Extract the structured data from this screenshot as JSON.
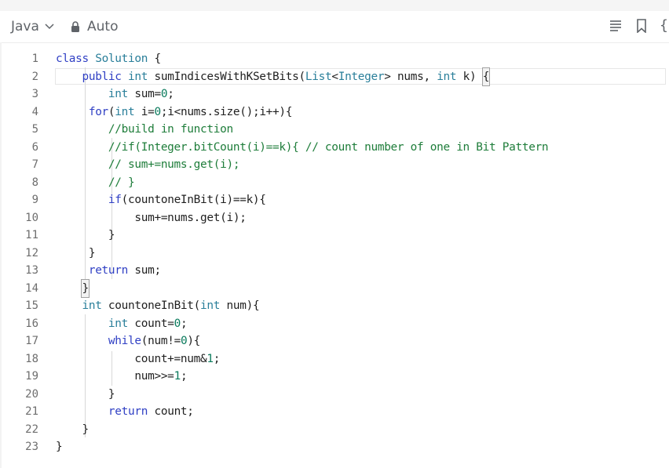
{
  "toolbar": {
    "language": "Java",
    "autocomplete": "Auto"
  },
  "icons": {
    "language_chevron": "chevron-down-icon",
    "lock": "lock-icon",
    "format": "format-list-icon",
    "bookmark": "bookmark-icon",
    "brace": "brace-icon"
  },
  "code": {
    "line_numbers": [
      "1",
      "2",
      "3",
      "4",
      "5",
      "6",
      "7",
      "8",
      "9",
      "10",
      "11",
      "12",
      "13",
      "14",
      "15",
      "16",
      "17",
      "18",
      "19",
      "20",
      "21",
      "22",
      "23"
    ],
    "lines": [
      "class Solution {",
      "    public int sumIndicesWithKSetBits(List<Integer> nums, int k) {",
      "        int sum=0;",
      "     for(int i=0;i<nums.size();i++){",
      "        //build in function",
      "        //if(Integer.bitCount(i)==k){ // count number of one in Bit Pattern",
      "        // sum+=nums.get(i);",
      "        // }",
      "        if(countoneInBit(i)==k){",
      "            sum+=nums.get(i);",
      "        }",
      "     }",
      "     return sum;",
      "    }",
      "    int countoneInBit(int num){",
      "        int count=0;",
      "        while(num!=0){",
      "            count+=num&1;",
      "            num>>=1;",
      "        }",
      "        return count;",
      "    }",
      "}"
    ]
  },
  "colors": {
    "keyword": "#2f3fc4",
    "type": "#2a7f9a",
    "comment": "#1e7d3a",
    "number": "#0a7a5c"
  }
}
